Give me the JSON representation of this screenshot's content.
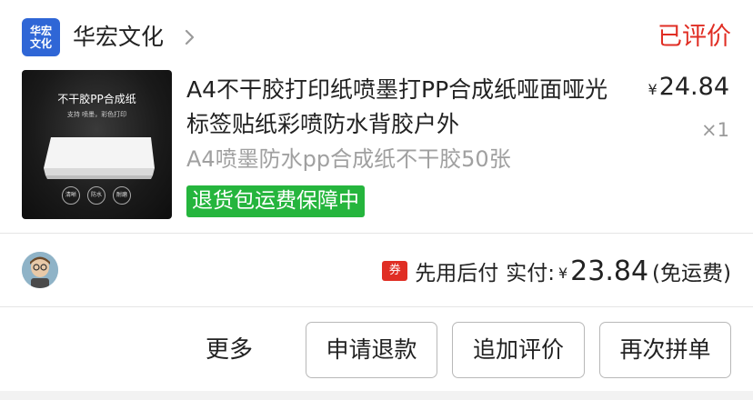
{
  "shop": {
    "logo_text_line1": "华宏",
    "logo_text_line2": "文化",
    "name": "华宏文化",
    "chevron_icon": "chevron-right-icon"
  },
  "order": {
    "status": "已评价"
  },
  "product": {
    "thumbnail": {
      "title": "不干胶PP合成纸",
      "subtitle": "支持 喷墨，彩色打印",
      "features": [
        "清晰",
        "防水",
        "耐磨"
      ]
    },
    "title": "A4不干胶打印纸喷墨打PP合成纸哑面哑光标签贴纸彩喷防水背胶户外",
    "spec": "A4喷墨防水pp合成纸不干胶50张",
    "guarantee_tag": "退货包运费保障中",
    "price_currency": "¥",
    "price": "24.84",
    "quantity": "×1"
  },
  "payment": {
    "coupon_icon_label": "券",
    "method_label": "先用后付",
    "paid_label": "实付:",
    "currency": "¥",
    "amount": "23.84",
    "shipping_note": "(免运费)"
  },
  "actions": {
    "more_label": "更多",
    "refund_label": "申请退款",
    "add_review_label": "追加评价",
    "reorder_label": "再次拼单"
  },
  "colors": {
    "status_red": "#e02e24",
    "guarantee_green": "#25b53d",
    "shop_logo_blue": "#2f66d6"
  }
}
